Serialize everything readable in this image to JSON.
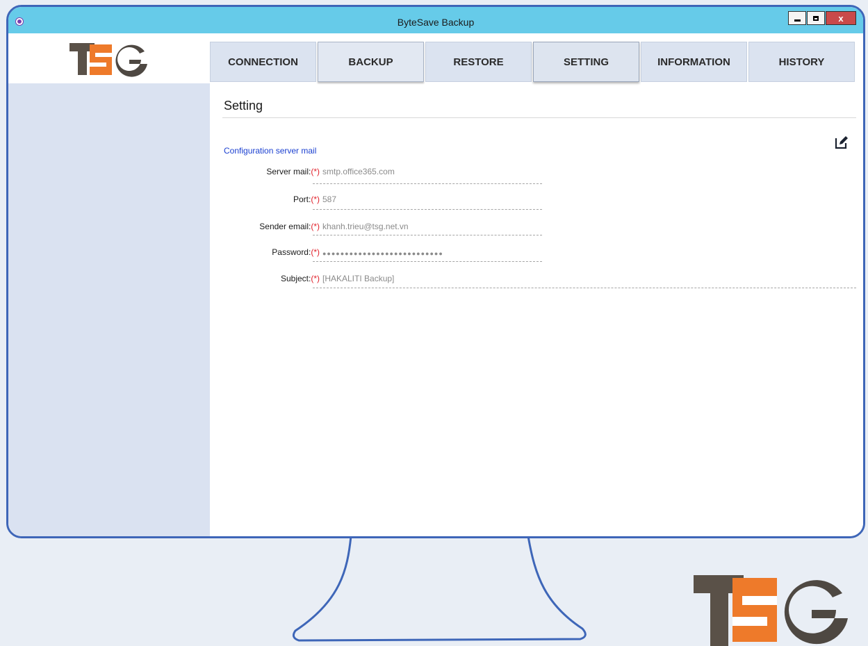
{
  "window": {
    "title": "ByteSave Backup",
    "close_label": "x"
  },
  "logo": {
    "text": "TSG",
    "colors": {
      "t": "#5a5148",
      "s_bg": "#ee7a2a",
      "s_stripe": "#ffffff",
      "g": "#4e4842"
    }
  },
  "tabs": [
    {
      "label": "CONNECTION",
      "state": "normal"
    },
    {
      "label": "BACKUP",
      "state": "raised"
    },
    {
      "label": "RESTORE",
      "state": "normal"
    },
    {
      "label": "SETTING",
      "state": "active"
    },
    {
      "label": "INFORMATION",
      "state": "normal"
    },
    {
      "label": "HISTORY",
      "state": "normal"
    }
  ],
  "page": {
    "title": "Setting",
    "section_link": "Configuration server mail",
    "edit_icon": "edit-pencil-icon"
  },
  "form": {
    "required_marker": "(*)",
    "fields": [
      {
        "label": "Server mail:",
        "value": "smtp.office365.com"
      },
      {
        "label": "Port:",
        "value": "587"
      },
      {
        "label": "Sender email:",
        "value": "khanh.trieu@tsg.net.vn"
      },
      {
        "label": "Password:",
        "value": "●●●●●●●●●●●●●●●●●●●●●●●●●●●"
      },
      {
        "label": "Subject:",
        "value": "[HAKALITI Backup]"
      }
    ]
  },
  "colors": {
    "titlebar": "#66cbe9",
    "frame": "#3e66b8",
    "sidebar": "#dae2f1",
    "link": "#1a3fd0",
    "required": "#e0202a"
  }
}
